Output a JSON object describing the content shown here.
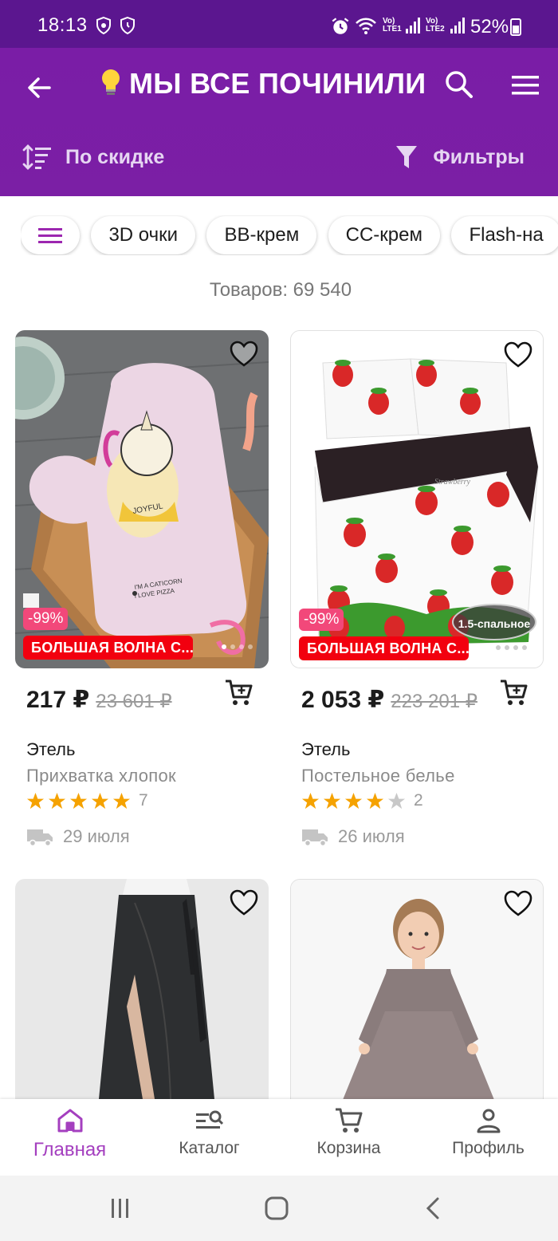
{
  "status_bar": {
    "time": "18:13",
    "net1": "Vo) LTE1",
    "net2": "Vo) LTE2",
    "battery": "52%"
  },
  "app_bar": {
    "title": "МЫ ВСЕ ПОЧИНИЛИ!...",
    "sort_label": "По скидке",
    "filter_label": "Фильтры",
    "accent_color": "#7b1fa2"
  },
  "chips": [
    "3D очки",
    "BB-крем",
    "CC-крем",
    "Flash-на"
  ],
  "items_count": "Товаров: 69 540",
  "products": [
    {
      "discount": "-99%",
      "promo": "БОЛЬШАЯ ВОЛНА С...",
      "price": "217 ₽",
      "old_price": "23 601 ₽",
      "brand": "Этель",
      "name": "Прихватка хлопок",
      "rating": 5,
      "reviews": "7",
      "delivery": "29 июля",
      "image_text": [
        "I'M A CATICORN",
        "I LOVE PIZZA",
        "JOYFUL"
      ],
      "image_count": 4
    },
    {
      "discount": "-99%",
      "promo": "БОЛЬШАЯ ВОЛНА С...",
      "price": "2 053 ₽",
      "old_price": "223 201 ₽",
      "brand": "Этель",
      "name": "Постельное белье",
      "rating": 4,
      "reviews": "2",
      "delivery": "26 июля",
      "image_badge": "1.5-спальное",
      "image_text": [
        "Strawberry"
      ],
      "image_count": 5
    }
  ],
  "bottom_nav": [
    {
      "label": "Главная",
      "icon": "home-icon",
      "active": true
    },
    {
      "label": "Каталог",
      "icon": "catalog-search-icon",
      "active": false
    },
    {
      "label": "Корзина",
      "icon": "cart-icon",
      "active": false
    },
    {
      "label": "Профиль",
      "icon": "profile-icon",
      "active": false
    }
  ]
}
